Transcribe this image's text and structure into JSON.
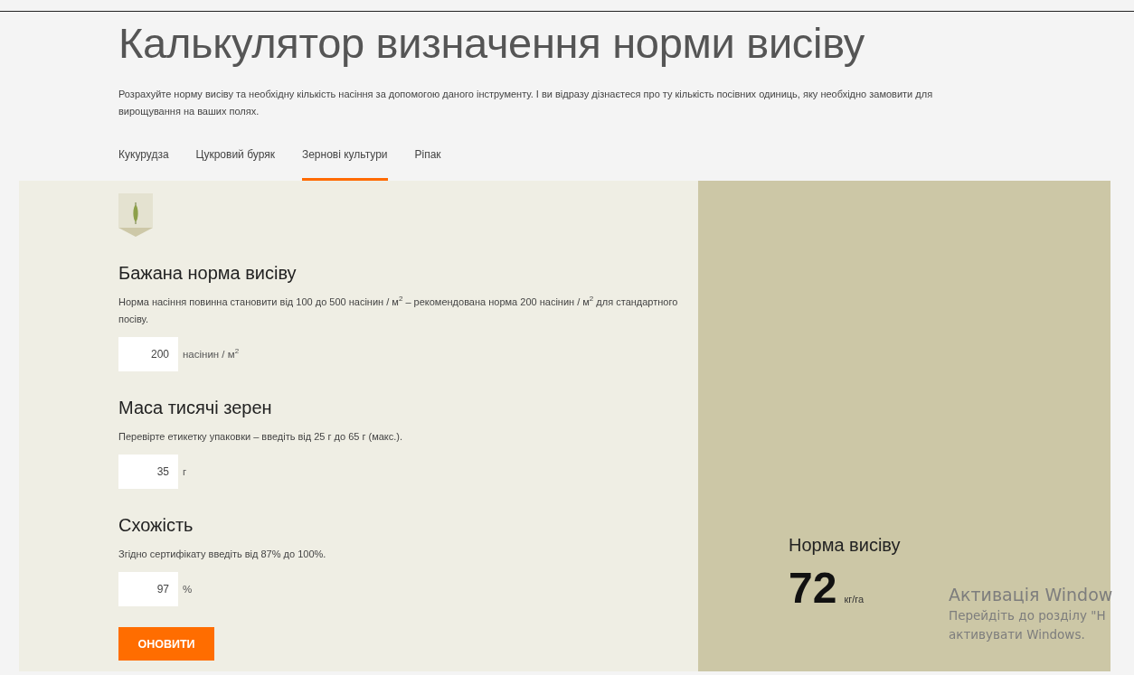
{
  "page": {
    "title": "Калькулятор визначення норми висіву",
    "intro": "Розрахуйте норму висіву та необхідну кількість насіння за допомогою даного інструменту. І ви відразу дізнаєтеся про ту кількість посівних одиниць, яку необхідно замовити для вирощування на ваших полях."
  },
  "tabs": [
    {
      "label": "Кукурудза",
      "selected": false
    },
    {
      "label": "Цукровий буряк",
      "selected": false
    },
    {
      "label": "Зернові культури",
      "selected": true
    },
    {
      "label": "Ріпак",
      "selected": false
    }
  ],
  "form": {
    "fields": [
      {
        "heading": "Бажана норма висіву",
        "hint": "Норма насіння повинна становити від 100 до 500 насінин / м$^{2}$ – рекомендована норма 200 насінин / м$^{2}$ для стандартного посіву.",
        "value": "200",
        "unit": "насінин / м$^{2}$"
      },
      {
        "heading": "Маса тисячі зерен",
        "hint": "Перевірте етикетку упаковки – введіть від 25 г до 65 г (макс.).",
        "value": "35",
        "unit": "г"
      },
      {
        "heading": "Схожість",
        "hint": "Згідно сертифікату введіть від 87% до 100%.",
        "value": "97",
        "unit": "%"
      }
    ],
    "button": "ОНОВИТИ"
  },
  "result": {
    "label": "Норма висіву",
    "value": "72",
    "unit": "кг/га"
  },
  "os_overlay": [
    "Активація Window",
    "Перейдіть до розділу \"Н",
    "активувати Windows."
  ]
}
